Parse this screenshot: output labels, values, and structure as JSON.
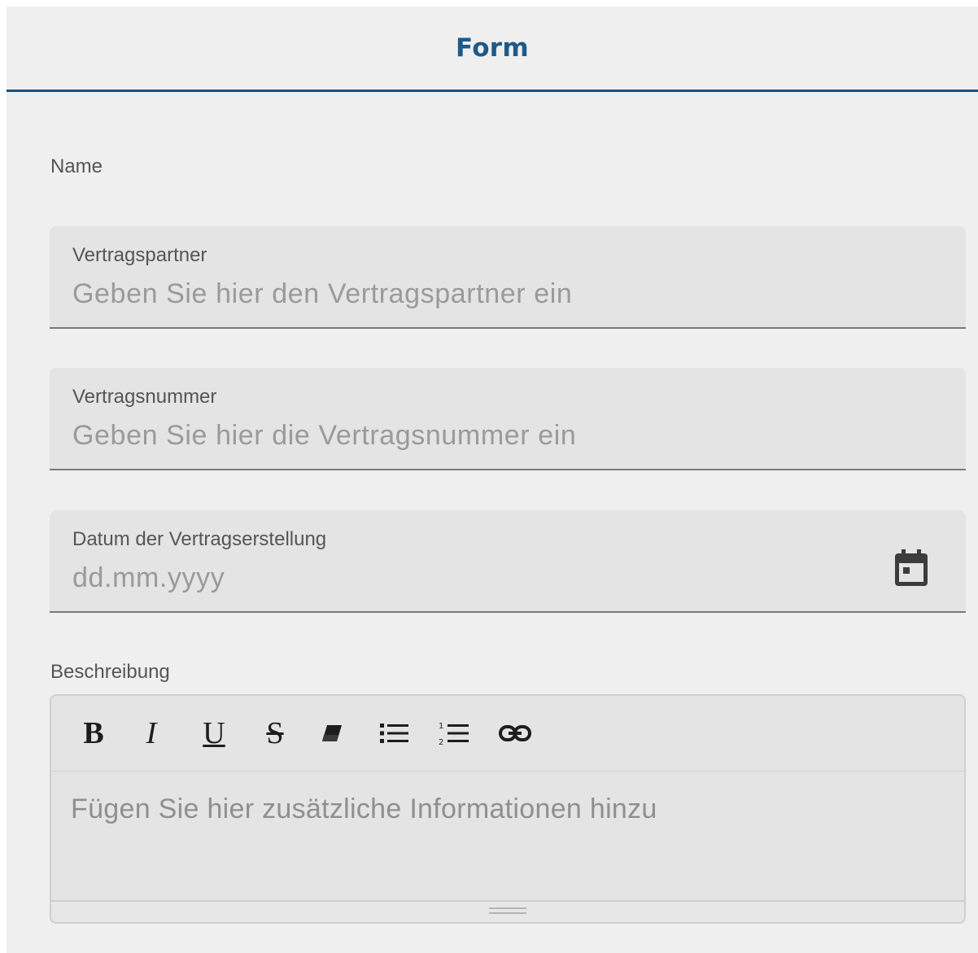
{
  "header": {
    "title": "Form"
  },
  "name_section": {
    "label": "Name"
  },
  "fields": [
    {
      "label": "Vertragspartner",
      "placeholder": "Geben Sie hier den Vertragspartner ein"
    },
    {
      "label": "Vertragsnummer",
      "placeholder": "Geben Sie hier die Vertragsnummer ein"
    },
    {
      "label": "Datum der Vertragserstellung",
      "placeholder": "dd.mm.yyyy",
      "icon": "calendar-icon"
    }
  ],
  "description": {
    "label": "Beschreibung",
    "toolbar": {
      "bold": "B",
      "italic": "I",
      "underline": "U",
      "strike": "S",
      "icons": [
        "eraser-icon",
        "bullet-list-icon",
        "numbered-list-icon",
        "link-icon"
      ]
    },
    "placeholder": "Fügen Sie hier zusätzliche Informationen hinzu"
  },
  "colors": {
    "accent": "#1f5a87",
    "background": "#efefef",
    "field_background": "#e4e4e4",
    "placeholder": "#9a9a9a"
  }
}
